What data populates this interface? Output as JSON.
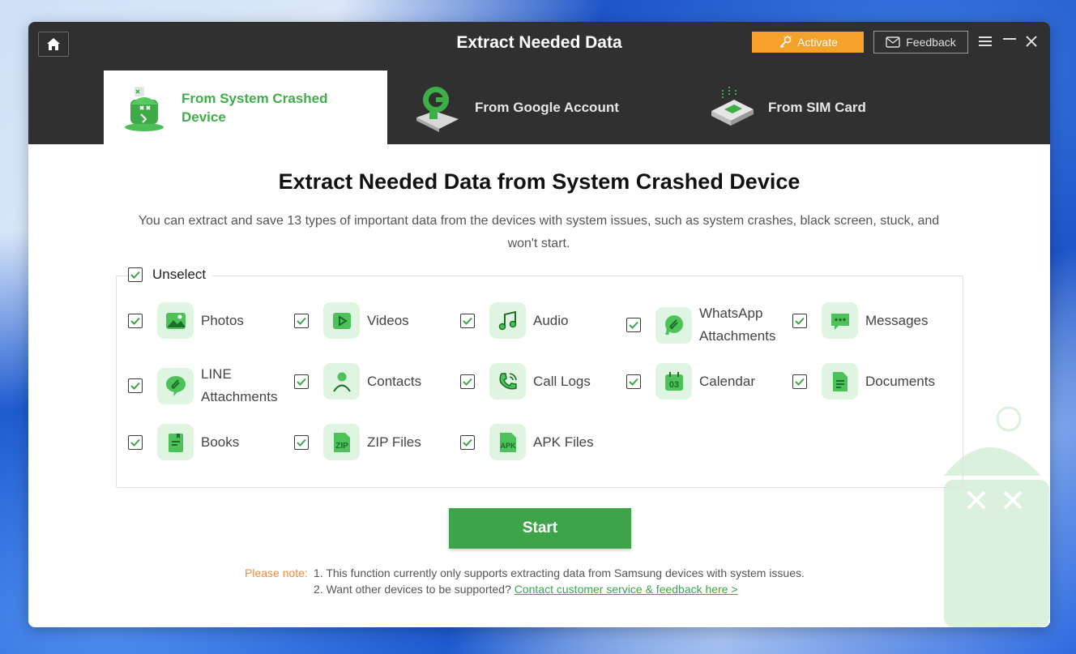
{
  "window": {
    "title": "Extract Needed Data"
  },
  "header": {
    "activate_label": "Activate",
    "feedback_label": "Feedback"
  },
  "tabs": [
    {
      "label": "From System Crashed Device",
      "active": true
    },
    {
      "label": "From Google Account",
      "active": false
    },
    {
      "label": "From SIM Card",
      "active": false
    }
  ],
  "main": {
    "title": "Extract Needed Data from System Crashed Device",
    "description": "You can extract and save 13 types of important data from the devices with system issues, such as system crashes, black screen, stuck, and won't start.",
    "unselect_label": "Unselect"
  },
  "data_types": [
    {
      "label": "Photos",
      "icon": "photo-icon",
      "checked": true
    },
    {
      "label": "Videos",
      "icon": "video-icon",
      "checked": true
    },
    {
      "label": "Audio",
      "icon": "audio-icon",
      "checked": true
    },
    {
      "label": "WhatsApp\nAttachments",
      "icon": "whatsapp-attachment-icon",
      "checked": true
    },
    {
      "label": "Messages",
      "icon": "messages-icon",
      "checked": true
    },
    {
      "label": "LINE\nAttachments",
      "icon": "line-attachment-icon",
      "checked": true
    },
    {
      "label": "Contacts",
      "icon": "contacts-icon",
      "checked": true
    },
    {
      "label": "Call Logs",
      "icon": "call-logs-icon",
      "checked": true
    },
    {
      "label": "Calendar",
      "icon": "calendar-icon",
      "checked": true
    },
    {
      "label": "Documents",
      "icon": "documents-icon",
      "checked": true
    },
    {
      "label": "Books",
      "icon": "books-icon",
      "checked": true
    },
    {
      "label": "ZIP Files",
      "icon": "zip-icon",
      "checked": true
    },
    {
      "label": "APK Files",
      "icon": "apk-icon",
      "checked": true
    }
  ],
  "start_label": "Start",
  "note": {
    "prefix": "Please note:",
    "line1": "1. This function currently only supports extracting data from Samsung devices with system issues.",
    "line2": "2. Want other devices to be supported?",
    "link": "Contact customer service & feedback here >"
  },
  "colors": {
    "accent": "#3fa34a",
    "activate": "#f5a12a",
    "titlebar": "#303030"
  }
}
